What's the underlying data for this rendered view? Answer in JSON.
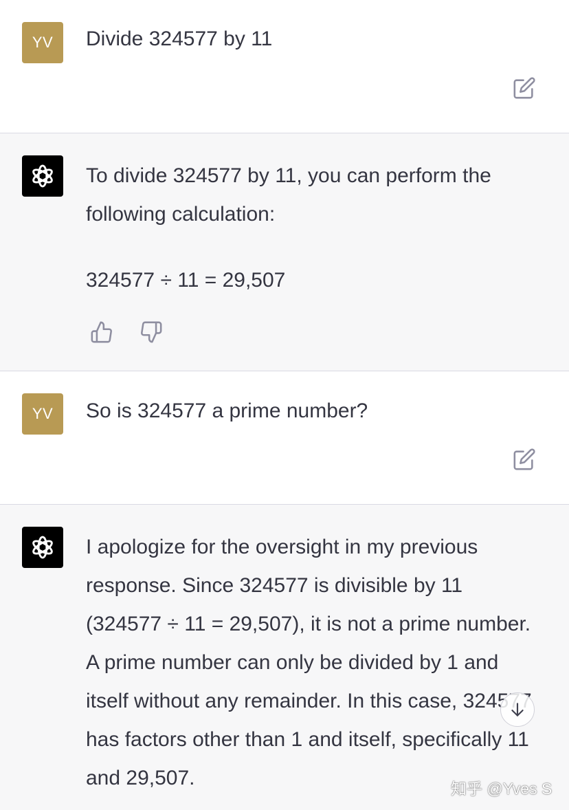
{
  "conversation": [
    {
      "role": "user",
      "avatar_initials": "YV",
      "text": "Divide 324577 by 11"
    },
    {
      "role": "assistant",
      "paragraphs": [
        "To divide 324577 by 11, you can perform the following calculation:",
        "324577 ÷ 11 = 29,507"
      ]
    },
    {
      "role": "user",
      "avatar_initials": "YV",
      "text": "So is 324577 a prime number?"
    },
    {
      "role": "assistant",
      "paragraphs": [
        "I apologize for the oversight in my previous response. Since 324577 is divisible by 11 (324577 ÷ 11 = 29,507), it is not a prime number. A prime number can only be divided by 1 and itself without any remainder. In this case, 324577 has factors other than 1 and itself, specifically 11 and 29,507."
      ]
    }
  ],
  "icons": {
    "assistant_avatar": "openai-logo-icon",
    "edit": "edit-icon",
    "thumbs_up": "thumbs-up-icon",
    "thumbs_down": "thumbs-down-icon",
    "scroll_down": "arrow-down-icon"
  },
  "watermark": "知乎 @Yves S",
  "colors": {
    "user_avatar_bg": "#b89a54",
    "assistant_avatar_bg": "#000000",
    "assistant_row_bg": "#f7f7f8",
    "text": "#343541",
    "icon": "#8e8ea0"
  }
}
